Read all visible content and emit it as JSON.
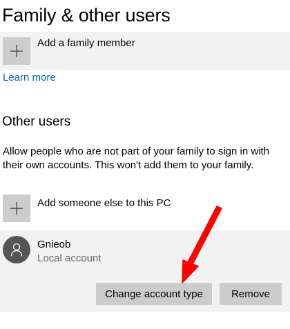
{
  "page": {
    "title": "Family & other users"
  },
  "family": {
    "add_label": "Add a family member",
    "learn_more": "Learn more"
  },
  "other_users": {
    "heading": "Other users",
    "description": "Allow people who are not part of your family to sign in with their own accounts. This won't add them to your family.",
    "add_label": "Add someone else to this PC",
    "user": {
      "name": "Gnieob",
      "type": "Local account",
      "change_type_button": "Change account type",
      "remove_button": "Remove"
    }
  },
  "icons": {
    "add_tile": "plus-icon",
    "avatar": "person-icon",
    "annotation": "red-arrow"
  },
  "colors": {
    "link": "#0063b1",
    "panel_bg": "#f2f2f2",
    "tile_bg": "#cccccc",
    "button_bg": "#cccccc",
    "avatar_bg": "#555555",
    "arrow": "#ff0000"
  }
}
